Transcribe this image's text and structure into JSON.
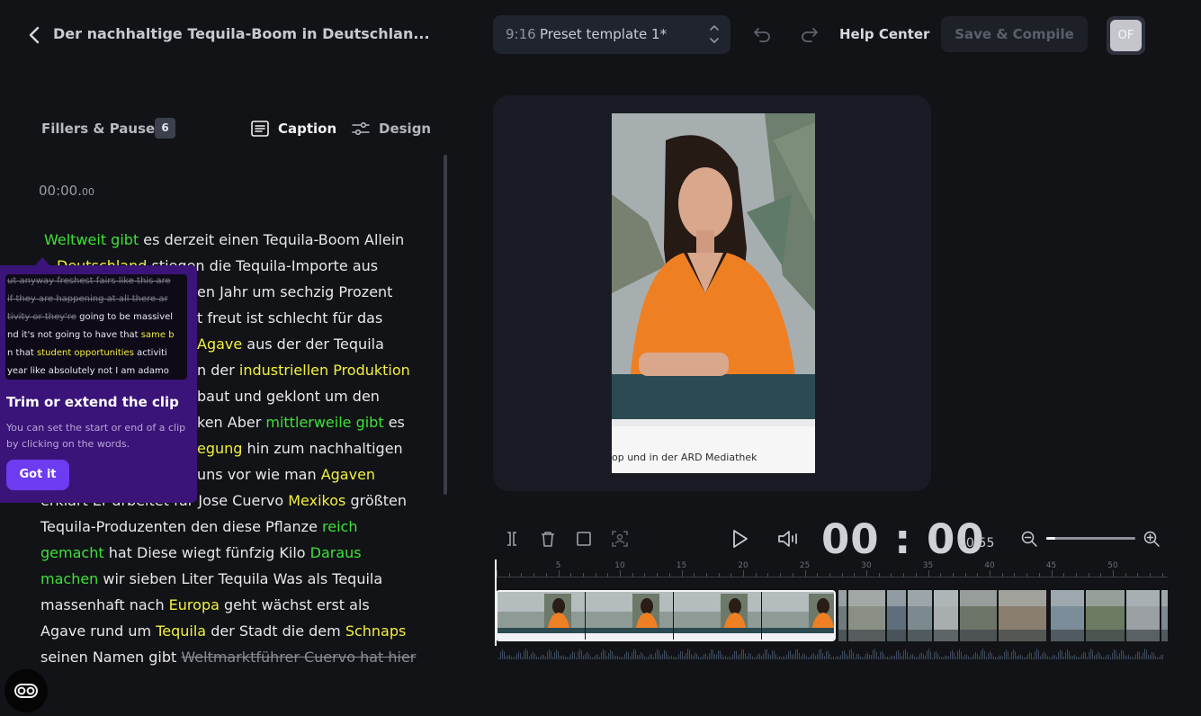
{
  "header": {
    "title": "Der nachhaltige Tequila-Boom in Deutschlan...",
    "preset_ratio": "9:16",
    "preset_name": "Preset template 1*",
    "help": "Help Center",
    "save": "Save & Compile",
    "avatar_initials": "OF"
  },
  "panel": {
    "fillers_label": "Fillers & Pauses",
    "fillers_count": "6",
    "tab_caption": "Caption",
    "tab_design": "Design",
    "timestamp_main": "00:00.",
    "timestamp_ms": "00"
  },
  "transcript": {
    "l1": {
      "a": "Weltweit gibt",
      "b": " es derzeit einen Tequila-Boom Allein"
    },
    "l2": {
      "a": "Deutschland",
      "b": " stiegen die Tequila-Importe aus"
    },
    "l3": {
      "a": "en Jahr um sechzig Prozent"
    },
    "l4": {
      "a": "t freut ist schlecht für das"
    },
    "l5": {
      "a": "Agave",
      "b": " aus der der Tequila"
    },
    "l6": {
      "a": "n der ",
      "b": "industriellen Produktion"
    },
    "l7": {
      "a": "baut und geklont um den"
    },
    "l8": {
      "a": "ken Aber ",
      "b": "mittlerweile gibt",
      "c": " es"
    },
    "l9": {
      "a": "egung",
      "b": " hin zum nachhaltigen"
    },
    "l10": {
      "a": "uns vor wie man ",
      "b": "Agaven"
    },
    "l11": {
      "a": "erklärt Er arbeitet für Jose Cuervo ",
      "b": "Mexikos",
      "c": " größten"
    },
    "l12": {
      "a": "Tequila-Produzenten den diese Pflanze ",
      "b": "reich"
    },
    "l13": {
      "a": "gemacht",
      "b": " hat Diese wiegt fünfzig Kilo ",
      "c": "Daraus"
    },
    "l14": {
      "a": "machen",
      "b": " wir sieben Liter Tequila  Was als Tequila"
    },
    "l15": {
      "a": "massenhaft nach ",
      "b": "Europa",
      "c": " geht wächst erst als"
    },
    "l16": {
      "a": "Agave rund um ",
      "b": "Tequila",
      "c": " der Stadt die dem ",
      "d": "Schnaps"
    },
    "l17": {
      "a": "seinen Namen gibt ",
      "b": "Weltmarktführer Cuervo hat hier"
    }
  },
  "tooltip": {
    "preview": {
      "p1": {
        "s": "ut anyway freshest fairs like this are"
      },
      "p2": {
        "s": "if they are happening at all there ar"
      },
      "p3": {
        "s": "tivity or they're",
        "t": " going to be massivel"
      },
      "p4": {
        "t": "nd it's not going to have that ",
        "y": "same b"
      },
      "p5": {
        "t": "n that ",
        "y": "student opportunities",
        "u": " activiti"
      },
      "p6": {
        "t": "year like absolutely not I am adamo"
      }
    },
    "title": "Trim or extend the clip",
    "body": "You can set the start or end of a clip by clicking on the words.",
    "button": "Got it"
  },
  "video": {
    "ticker": "op und in der ARD Mediathek"
  },
  "controls": {
    "time_current": "00 : 00",
    "time_total": "00:55",
    "zoom_level": 0.1
  },
  "timeline": {
    "ticks": [
      "5",
      "10",
      "15",
      "20",
      "25",
      "30",
      "35",
      "40",
      "45",
      "50"
    ]
  },
  "colors": {
    "filler_highlight": "#3ee03a",
    "keyword_highlight": "#f3f040",
    "tooltip_bg": "#3a1478",
    "button_accent": "#6d3bf0"
  }
}
